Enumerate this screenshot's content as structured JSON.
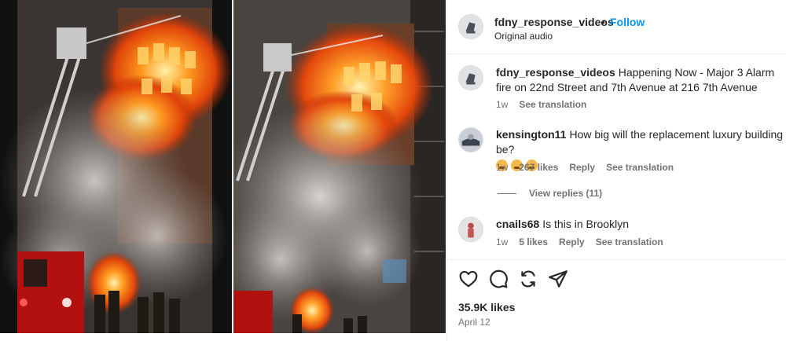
{
  "post": {
    "username": "fdny_response_videos",
    "dot": "•",
    "follow_label": "Follow",
    "audio": "Original audio"
  },
  "comments": [
    {
      "username": "fdny_response_videos",
      "text": "Happening Now - Major 3 Alarm fire on 22nd Street and 7th Avenue at 216 7th Avenue",
      "time": "1w",
      "see_translation": "See translation"
    },
    {
      "username": "kensington11",
      "text": "How big will the replacement luxury building be?",
      "emojis": [
        "grimacing-face",
        "grimacing-face",
        "grimacing-face"
      ],
      "time": "1w",
      "likes": "267 likes",
      "reply": "Reply",
      "see_translation": "See translation",
      "view_replies": "View replies (11)"
    },
    {
      "username": "cnails68",
      "text": "Is this in Brooklyn",
      "time": "1w",
      "likes": "5 likes",
      "reply": "Reply",
      "see_translation": "See translation"
    }
  ],
  "actions": {
    "icons": [
      "heart-icon",
      "comment-icon",
      "repost-icon",
      "share-icon"
    ]
  },
  "likes_count": "35.9K likes",
  "date": "April 12",
  "colors": {
    "follow": "#0095f6",
    "text": "#262626",
    "muted": "#737373",
    "fire": "#ff6a00"
  }
}
